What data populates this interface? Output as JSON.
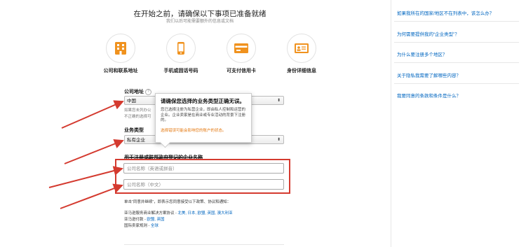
{
  "header": {
    "title": "在开始之前，请确保以下事项已准备就绪",
    "subtitle": "我们以后可能需要额外的信息或文档"
  },
  "requirements": [
    {
      "label": "公司和联系地址",
      "icon": "building-icon"
    },
    {
      "label": "手机或固话号码",
      "icon": "phone-icon"
    },
    {
      "label": "可支付信用卡",
      "icon": "credit-card-icon"
    },
    {
      "label": "身份详细信息",
      "icon": "id-card-icon"
    }
  ],
  "form": {
    "address_label": "公司地址",
    "country_value": "中国",
    "address_note_1": "如果您未列办公",
    "address_note_2": "不正确的选择可",
    "business_type_label": "业务类型",
    "business_type_value": "私有企业",
    "company_name_label": "用于注册或联邦政府登记的企业名称",
    "name_pinyin_placeholder": "公司名称（英语或拼音）",
    "name_chinese_placeholder": "公司名称（中文）"
  },
  "tooltip": {
    "title": "请确保您选择的业务类型正确无误。",
    "body": "您已选择注册为私营企业，即由私人控制和运营的企业。企业卖家是在商业或专业活动的背景下注册的。",
    "warning": "选择错误可能会影响您的账户的状态。"
  },
  "legal": {
    "intro": "单击“同意并继续”，即表示您同意接受以下政策、协议和通知：",
    "line1_prefix": "亚马逊服务商业解决方案协议 - ",
    "line1_links": "北美, 日本, 欧盟, 英国, 澳大利亚",
    "line2_prefix": "亚马逊付款 - ",
    "line2_links": "欧盟, 英国",
    "line3_prefix": "国际卖家规则 - ",
    "line3_links": "全球"
  },
  "sidebar": {
    "faqs": [
      "如果我所在的国家/地区不在列表中，该怎么办？",
      "为何需要提供我的“企业类型”？",
      "为什么要注册多个地区？",
      "关于隐私我需要了解哪些内容？",
      "我要同意的条款和条件是什么？"
    ]
  },
  "colors": {
    "accent_orange": "#e47911",
    "highlight_red": "#d43a2f",
    "link_blue": "#0066c0"
  }
}
